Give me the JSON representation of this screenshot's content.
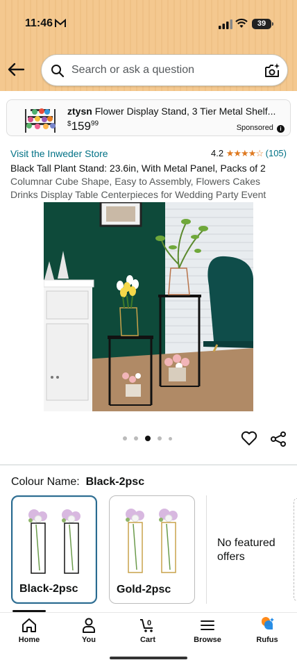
{
  "status_bar": {
    "time": "11:46",
    "battery": "39"
  },
  "search": {
    "placeholder": "Search or ask a question"
  },
  "ad": {
    "brand": "ztysn",
    "title": "Flower Display Stand, 3 Tier Metal Shelf...",
    "price_symbol": "$",
    "price_whole": "159",
    "price_fraction": "99",
    "sponsored_label": "Sponsored"
  },
  "product": {
    "store_link": "Visit the Inweder Store",
    "rating_value": "4.2",
    "rating_stars": 4.2,
    "rating_count": "(105)",
    "title": "Black Tall Plant Stand: 23.6in, With Metal Panel, Packs of 2",
    "subtitle": "Columnar Cube Shape, Easy to Assembly, Flowers Cakes Drinks Display Table Centerpieces for Wedding Party Event",
    "image_count": 5,
    "active_image_index": 2
  },
  "variations": {
    "label": "Colour Name:",
    "selected_value": "Black-2psc",
    "options": [
      {
        "label": "Black-2psc",
        "selected": true
      },
      {
        "label": "Gold-2psc",
        "selected": false
      }
    ],
    "no_offers_text": "No featured offers"
  },
  "bottom_nav": {
    "items": [
      {
        "label": "Home",
        "icon": "home-icon"
      },
      {
        "label": "You",
        "icon": "person-icon"
      },
      {
        "label": "Cart",
        "icon": "cart-icon",
        "badge": "0"
      },
      {
        "label": "Browse",
        "icon": "menu-icon"
      },
      {
        "label": "Rufus",
        "icon": "rufus-icon"
      }
    ]
  },
  "colors": {
    "link": "#007185",
    "star": "#de7921",
    "header_bg": "#f4c88f",
    "selected_border": "#2a6a8f"
  }
}
